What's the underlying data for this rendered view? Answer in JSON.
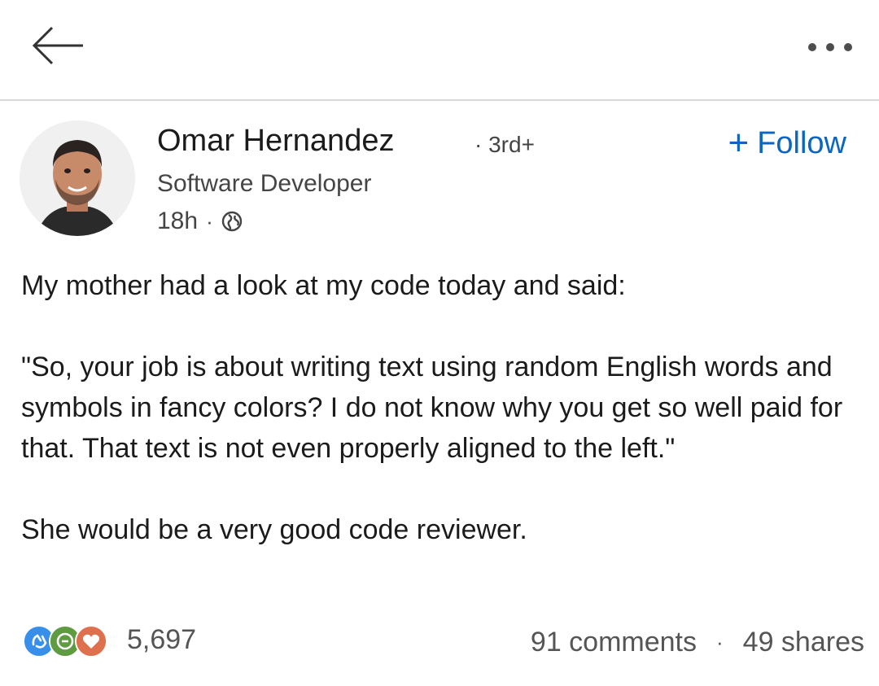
{
  "nav": {
    "back_icon": "arrow-left-icon",
    "more_icon": "more-horizontal-icon"
  },
  "author": {
    "name": "Omar Hernandez",
    "degree": "· 3rd+",
    "headline": "Software Developer",
    "time": "18h",
    "visibility_icon": "globe-icon",
    "avatar_icon": "profile-photo"
  },
  "follow": {
    "plus": "+",
    "label": "Follow"
  },
  "post": {
    "paragraphs": [
      "My mother had a look at my code today and said:",
      "\"So, your job is about writing text using random English words and symbols in fancy colors? I do not know why you get so well paid for that. That text is not even properly aligned to the left.\"",
      "She would be a very good code reviewer."
    ]
  },
  "social": {
    "reactions_count": "5,697",
    "comments": "91 comments",
    "shares": "49 shares",
    "reaction_icons": [
      "clap-icon",
      "celebrate-icon",
      "heart-icon"
    ]
  },
  "colors": {
    "accent": "#0a66c2",
    "reaction_blue": "#378fe9",
    "reaction_green": "#44712e",
    "reaction_red": "#df704d"
  }
}
